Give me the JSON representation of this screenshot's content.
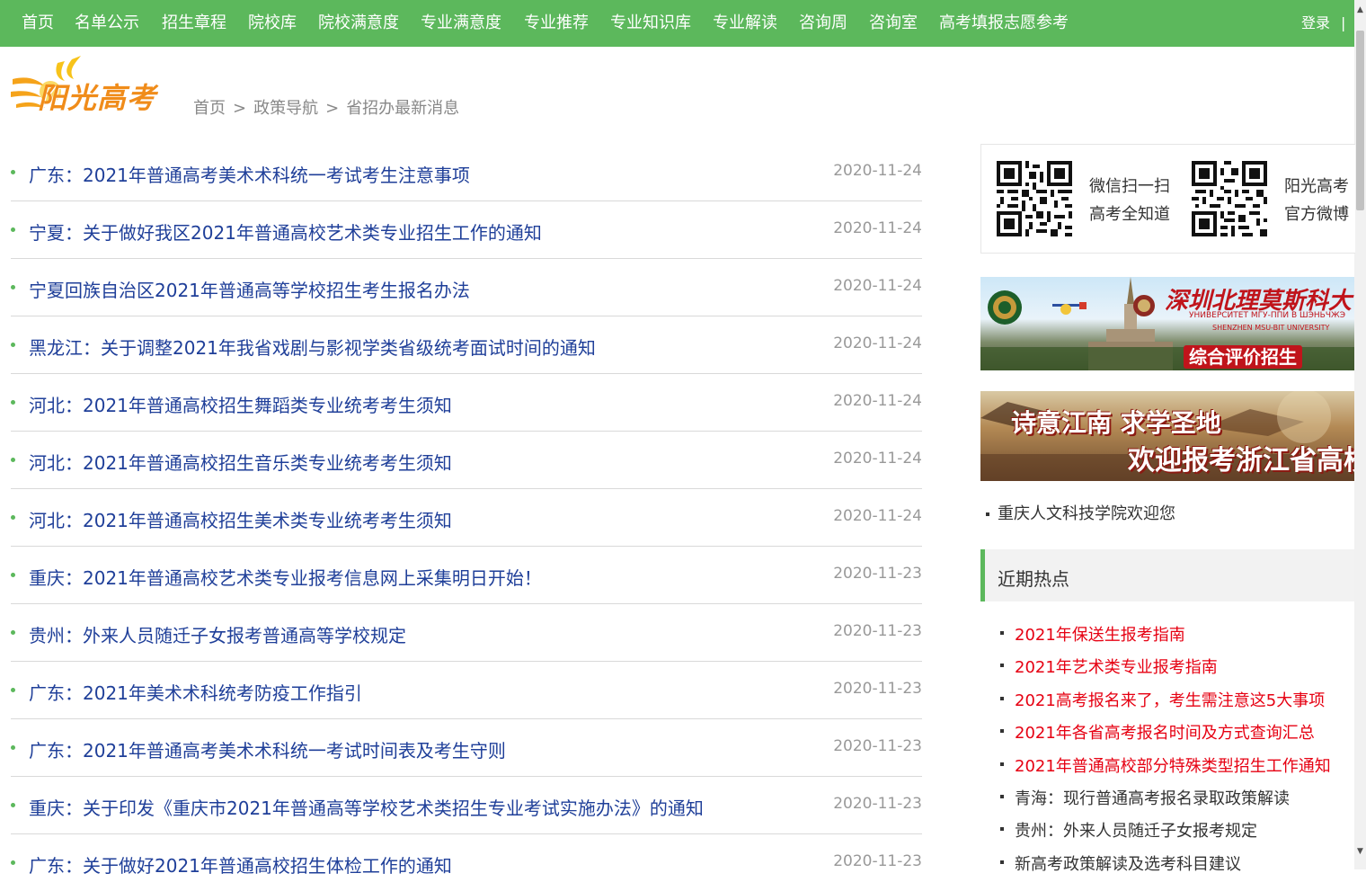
{
  "nav": {
    "items": [
      "首页",
      "名单公示",
      "招生章程",
      "院校库",
      "院校满意度",
      "专业满意度",
      "专业推荐",
      "专业知识库",
      "专业解读",
      "咨询周",
      "咨询室",
      "高考填报志愿参考"
    ],
    "login": "登录",
    "separator": "|"
  },
  "logo": {
    "text": "阳光高考"
  },
  "breadcrumb": {
    "items": [
      "首页",
      "政策导航",
      "省招办最新消息"
    ],
    "separator": ">"
  },
  "news": [
    {
      "title": "广东：2021年普通高考美术术科统一考试考生注意事项",
      "date": "2020-11-24"
    },
    {
      "title": "宁夏：关于做好我区2021年普通高校艺术类专业招生工作的通知",
      "date": "2020-11-24"
    },
    {
      "title": "宁夏回族自治区2021年普通高等学校招生考生报名办法",
      "date": "2020-11-24"
    },
    {
      "title": "黑龙江：关于调整2021年我省戏剧与影视学类省级统考面试时间的通知",
      "date": "2020-11-24"
    },
    {
      "title": "河北：2021年普通高校招生舞蹈类专业统考考生须知",
      "date": "2020-11-24"
    },
    {
      "title": "河北：2021年普通高校招生音乐类专业统考考生须知",
      "date": "2020-11-24"
    },
    {
      "title": "河北：2021年普通高校招生美术类专业统考考生须知",
      "date": "2020-11-24"
    },
    {
      "title": "重庆：2021年普通高校艺术类专业报考信息网上采集明日开始！",
      "date": "2020-11-23"
    },
    {
      "title": "贵州：外来人员随迁子女报考普通高等学校规定",
      "date": "2020-11-23"
    },
    {
      "title": "广东：2021年美术术科统考防疫工作指引",
      "date": "2020-11-23"
    },
    {
      "title": "广东：2021年普通高考美术术科统一考试时间表及考生守则",
      "date": "2020-11-23"
    },
    {
      "title": "重庆：关于印发《重庆市2021年普通高等学校艺术类招生专业考试实施办法》的通知",
      "date": "2020-11-23"
    },
    {
      "title": "广东：关于做好2021年普通高校招生体检工作的通知",
      "date": "2020-11-23"
    }
  ],
  "sidebar": {
    "qr1": {
      "line1": "微信扫一扫",
      "line2": "高考全知道"
    },
    "qr2": {
      "line1": "阳光高考",
      "line2": "官方微博"
    },
    "banner1": {
      "title": "深圳北理莫斯科大",
      "subtitle": "УНИВЕРСИТЕТ МГУ-ППИ В ШЭНЬЧЖЭ",
      "subtitle2": "SHENZHEN MSU-BIT UNIVERSITY",
      "badge": "综合评价招生"
    },
    "banner2": {
      "line1": "诗意江南 求学圣地",
      "line2": "欢迎报考浙江省高校"
    },
    "welcome": "重庆人文科技学院欢迎您",
    "hot_title": "近期热点",
    "hot_items": [
      {
        "text": "2021年保送生报考指南",
        "color": "#e60012"
      },
      {
        "text": "2021年艺术类专业报考指南",
        "color": "#e60012"
      },
      {
        "text": "2021高考报名来了，考生需注意这5大事项",
        "color": "#e60012"
      },
      {
        "text": "2021年各省高考报名时间及方式查询汇总",
        "color": "#e60012"
      },
      {
        "text": "2021年普通高校部分特殊类型招生工作通知",
        "color": "#e60012"
      },
      {
        "text": "青海：现行普通高考报名录取政策解读",
        "color": "#333333"
      },
      {
        "text": "贵州：外来人员随迁子女报考规定",
        "color": "#333333"
      },
      {
        "text": "新高考政策解读及选考科目建议",
        "color": "#333333"
      }
    ]
  },
  "colors": {
    "accent": "#5cb85c",
    "link": "#1f3f99",
    "hot": "#e60012"
  }
}
